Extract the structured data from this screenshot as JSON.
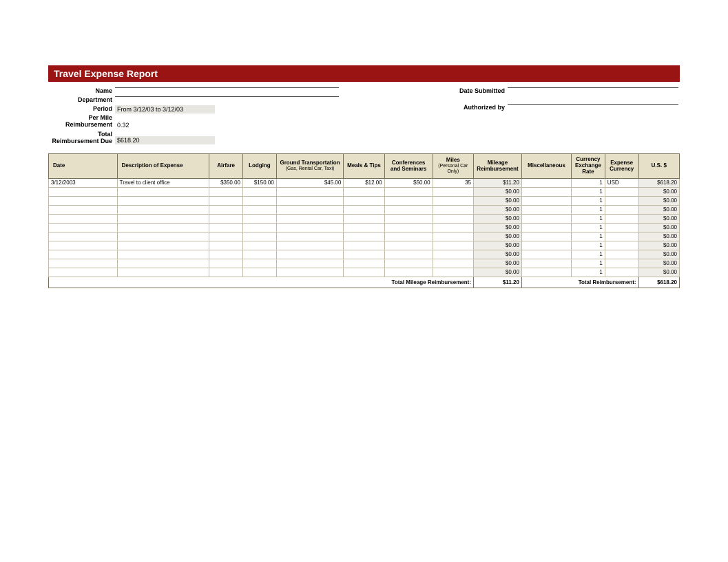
{
  "title": "Travel Expense Report",
  "header": {
    "left": {
      "name_label": "Name",
      "name_value": "",
      "department_label": "Department",
      "department_value": "",
      "period_label": "Period",
      "period_value": "From 3/12/03 to 3/12/03",
      "permile_label": "Per Mile Reimbursement",
      "permile_value": "0.32",
      "total_label": "Total Reimbursement Due",
      "total_value": "$618.20"
    },
    "right": {
      "submitted_label": "Date Submitted",
      "submitted_value": "",
      "authorized_label": "Authorized by",
      "authorized_value": ""
    }
  },
  "columns": {
    "date": "Date",
    "desc": "Description of Expense",
    "airfare": "Airfare",
    "lodging": "Lodging",
    "ground": "Ground Transportation",
    "ground_sub": "(Gas, Rental Car, Taxi)",
    "meals": "Meals & Tips",
    "conf": "Conferences and Seminars",
    "miles": "Miles",
    "miles_sub": "(Personal Car Only)",
    "mileage": "Mileage Reimbursement",
    "misc": "Miscellaneous",
    "exch": "Currency Exchange Rate",
    "curr": "Expense Currency",
    "usd": "U.S. $"
  },
  "rows": [
    {
      "date": "3/12/2003",
      "desc": "Travel to client office",
      "airfare": "$350.00",
      "lodging": "$150.00",
      "ground": "$45.00",
      "meals": "$12.00",
      "conf": "$50.00",
      "miles": "35",
      "mileage": "$11.20",
      "misc": "",
      "exch": "1",
      "curr": "USD",
      "usd": "$618.20"
    },
    {
      "date": "",
      "desc": "",
      "airfare": "",
      "lodging": "",
      "ground": "",
      "meals": "",
      "conf": "",
      "miles": "",
      "mileage": "$0.00",
      "misc": "",
      "exch": "1",
      "curr": "",
      "usd": "$0.00"
    },
    {
      "date": "",
      "desc": "",
      "airfare": "",
      "lodging": "",
      "ground": "",
      "meals": "",
      "conf": "",
      "miles": "",
      "mileage": "$0.00",
      "misc": "",
      "exch": "1",
      "curr": "",
      "usd": "$0.00"
    },
    {
      "date": "",
      "desc": "",
      "airfare": "",
      "lodging": "",
      "ground": "",
      "meals": "",
      "conf": "",
      "miles": "",
      "mileage": "$0.00",
      "misc": "",
      "exch": "1",
      "curr": "",
      "usd": "$0.00"
    },
    {
      "date": "",
      "desc": "",
      "airfare": "",
      "lodging": "",
      "ground": "",
      "meals": "",
      "conf": "",
      "miles": "",
      "mileage": "$0.00",
      "misc": "",
      "exch": "1",
      "curr": "",
      "usd": "$0.00"
    },
    {
      "date": "",
      "desc": "",
      "airfare": "",
      "lodging": "",
      "ground": "",
      "meals": "",
      "conf": "",
      "miles": "",
      "mileage": "$0.00",
      "misc": "",
      "exch": "1",
      "curr": "",
      "usd": "$0.00"
    },
    {
      "date": "",
      "desc": "",
      "airfare": "",
      "lodging": "",
      "ground": "",
      "meals": "",
      "conf": "",
      "miles": "",
      "mileage": "$0.00",
      "misc": "",
      "exch": "1",
      "curr": "",
      "usd": "$0.00"
    },
    {
      "date": "",
      "desc": "",
      "airfare": "",
      "lodging": "",
      "ground": "",
      "meals": "",
      "conf": "",
      "miles": "",
      "mileage": "$0.00",
      "misc": "",
      "exch": "1",
      "curr": "",
      "usd": "$0.00"
    },
    {
      "date": "",
      "desc": "",
      "airfare": "",
      "lodging": "",
      "ground": "",
      "meals": "",
      "conf": "",
      "miles": "",
      "mileage": "$0.00",
      "misc": "",
      "exch": "1",
      "curr": "",
      "usd": "$0.00"
    },
    {
      "date": "",
      "desc": "",
      "airfare": "",
      "lodging": "",
      "ground": "",
      "meals": "",
      "conf": "",
      "miles": "",
      "mileage": "$0.00",
      "misc": "",
      "exch": "1",
      "curr": "",
      "usd": "$0.00"
    },
    {
      "date": "",
      "desc": "",
      "airfare": "",
      "lodging": "",
      "ground": "",
      "meals": "",
      "conf": "",
      "miles": "",
      "mileage": "$0.00",
      "misc": "",
      "exch": "1",
      "curr": "",
      "usd": "$0.00"
    }
  ],
  "footer": {
    "mileage_label": "Total Mileage Reimbursement:",
    "mileage_value": "$11.20",
    "total_label": "Total Reimbursement:",
    "total_value": "$618.20"
  }
}
